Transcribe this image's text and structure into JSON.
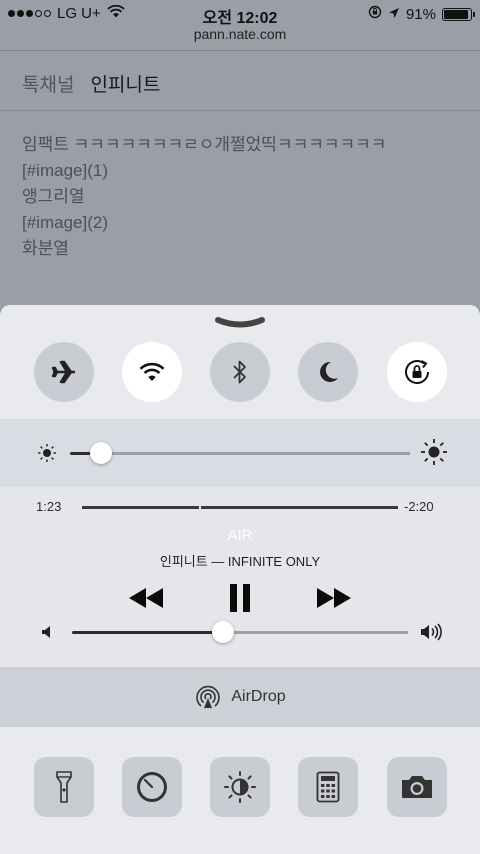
{
  "status_bar": {
    "carrier": "LG U+",
    "time": "오전 12:02",
    "battery": "91%",
    "battery_level": 0.91,
    "signal_bars": 3
  },
  "browser": {
    "url": "pann.nate.com"
  },
  "page": {
    "breadcrumb": "톡채널",
    "title": "인피니트",
    "lines": [
      "임팩트 ㅋㅋㅋㅋㅋㅋㅋㄹㅇ개쩔었띡ㅋㅋㅋㅋㅋㅋㅋ",
      "[#image](1)",
      "앵그리열",
      "[#image](2)",
      "화분열"
    ]
  },
  "control_center": {
    "toggles": [
      {
        "name": "airplane-mode",
        "icon": "airplane-icon",
        "on": false
      },
      {
        "name": "wifi",
        "icon": "wifi-icon",
        "on": true
      },
      {
        "name": "bluetooth",
        "icon": "bluetooth-icon",
        "on": false
      },
      {
        "name": "do-not-disturb",
        "icon": "moon-icon",
        "on": false
      },
      {
        "name": "rotation-lock",
        "icon": "rotation-lock-icon",
        "on": true
      }
    ],
    "brightness_level": 0.09,
    "media": {
      "elapsed": "1:23",
      "remaining": "-2:20",
      "progress": 0.37,
      "title": "AIR",
      "subtitle": "인피니트 — INFINITE ONLY",
      "volume_level": 0.45
    },
    "airdrop_label": "AirDrop",
    "shortcuts": [
      {
        "name": "flashlight",
        "icon": "flashlight-icon"
      },
      {
        "name": "timer",
        "icon": "timer-icon"
      },
      {
        "name": "night-shift",
        "icon": "night-shift-icon"
      },
      {
        "name": "calculator",
        "icon": "calculator-icon"
      },
      {
        "name": "camera",
        "icon": "camera-icon"
      }
    ]
  },
  "colors": {
    "toggle_off": "#c9ccd3",
    "toggle_on": "#ffffff",
    "panel": "#e8eaee"
  }
}
